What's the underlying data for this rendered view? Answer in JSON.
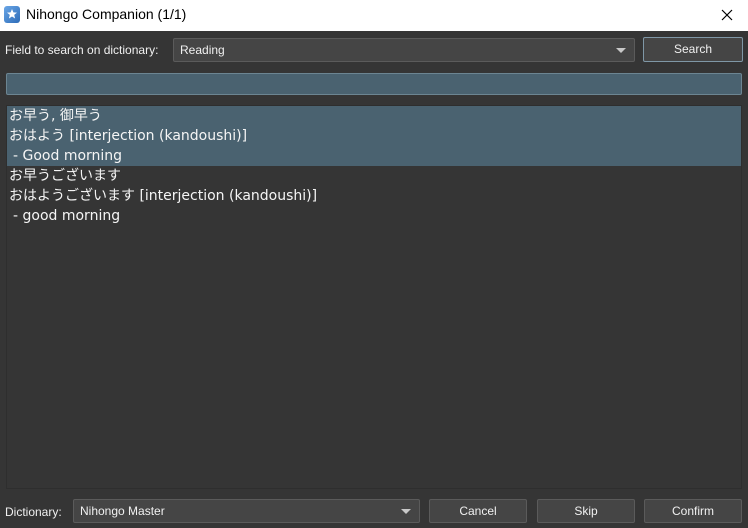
{
  "window": {
    "title": "Nihongo Companion (1/1)"
  },
  "search_bar": {
    "field_label": "Field to search on dictionary:",
    "field_value": "Reading",
    "search_button": "Search",
    "query": ""
  },
  "results": [
    {
      "kanji": "お早う, 御早う",
      "reading": "おはよう [interjection (kandoushi)]",
      "meaning": " - Good morning",
      "selected": true
    },
    {
      "kanji": "お早うございます",
      "reading": "おはようございます [interjection (kandoushi)]",
      "meaning": " - good morning",
      "selected": false
    }
  ],
  "footer": {
    "dictionary_label": "Dictionary:",
    "dictionary_value": "Nihongo Master",
    "cancel": "Cancel",
    "skip": "Skip",
    "confirm": "Confirm"
  },
  "colors": {
    "background": "#353535",
    "selection": "#4a6270",
    "accent_border": "#7f97a6"
  }
}
